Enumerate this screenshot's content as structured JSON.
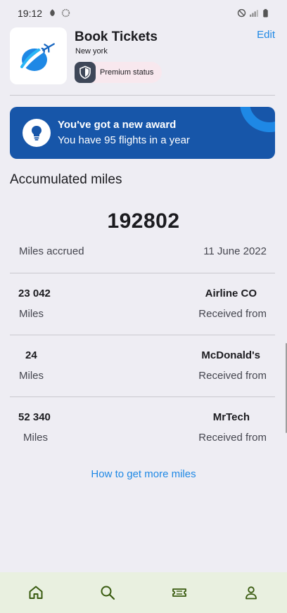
{
  "status_bar": {
    "time": "19:12",
    "left_icons": [
      "notification-icon",
      "sync-icon"
    ],
    "right_icons": [
      "do-not-disturb-icon",
      "signal-icon",
      "battery-icon"
    ]
  },
  "header": {
    "logo_icon": "plane-globe-logo-icon",
    "title": "Book Tickets",
    "location": "New york",
    "badge": {
      "icon": "shield-icon",
      "label": "Premium status"
    },
    "edit_label": "Edit"
  },
  "award": {
    "icon": "lightbulb-icon",
    "title": "You've got a new award",
    "text": "You have 95 flights in a year"
  },
  "miles": {
    "section_title": "Accumulated miles",
    "total": "192802",
    "accrued_label": "Miles accrued",
    "accrued_date": "11 June 2022"
  },
  "transactions": [
    {
      "amount": "23 042",
      "unit": "Miles",
      "source": "Airline CO",
      "received_label": "Received from"
    },
    {
      "amount": "24",
      "unit": "Miles",
      "source": "McDonald's",
      "received_label": "Received from"
    },
    {
      "amount": "52 340",
      "unit": "Miles",
      "source": "MrTech",
      "received_label": "Received from"
    }
  ],
  "more_link": "How to get more miles",
  "bottom_nav": {
    "items": [
      "home-icon",
      "search-icon",
      "ticket-icon",
      "profile-icon"
    ],
    "active_color": "#385A0E"
  },
  "colors": {
    "background": "#EEEDF3",
    "banner": "#1756A9",
    "accent": "#1E88E5",
    "nav_background": "#E9F0E0"
  }
}
